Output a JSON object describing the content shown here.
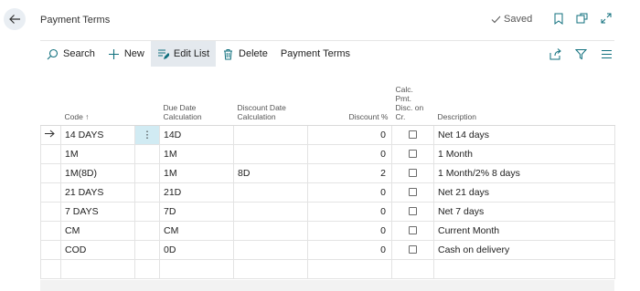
{
  "header": {
    "title": "Payment Terms",
    "saved_label": "Saved"
  },
  "toolbar": {
    "search_label": "Search",
    "new_label": "New",
    "edit_list_label": "Edit List",
    "delete_label": "Delete",
    "payment_terms_label": "Payment Terms"
  },
  "table": {
    "columns": {
      "code": "Code ↑",
      "due_date": "Due Date Calculation",
      "discount_date": "Discount Date Calculation",
      "discount_pct": "Discount %",
      "calc_pmt": "Calc. Pmt. Disc. on Cr.",
      "description": "Description"
    },
    "rows": [
      {
        "code": "14 DAYS",
        "due": "14D",
        "disc_date": "",
        "pct": "0",
        "desc": "Net 14 days"
      },
      {
        "code": "1M",
        "due": "1M",
        "disc_date": "",
        "pct": "0",
        "desc": "1 Month"
      },
      {
        "code": "1M(8D)",
        "due": "1M",
        "disc_date": "8D",
        "pct": "2",
        "desc": "1 Month/2% 8 days"
      },
      {
        "code": "21 DAYS",
        "due": "21D",
        "disc_date": "",
        "pct": "0",
        "desc": "Net 21 days"
      },
      {
        "code": "7 DAYS",
        "due": "7D",
        "disc_date": "",
        "pct": "0",
        "desc": "Net 7 days"
      },
      {
        "code": "CM",
        "due": "CM",
        "disc_date": "",
        "pct": "0",
        "desc": "Current Month"
      },
      {
        "code": "COD",
        "due": "0D",
        "disc_date": "",
        "pct": "0",
        "desc": "Cash on delivery"
      }
    ]
  },
  "icons": {
    "back": "arrow-left-icon",
    "saved_check": "check-icon",
    "bookmark": "bookmark-icon",
    "open_new": "open-in-new-window-icon",
    "expand": "expand-icon",
    "search": "search-icon",
    "new": "plus-icon",
    "edit_list": "edit-list-icon",
    "delete": "trash-icon",
    "share": "share-icon",
    "filter": "filter-icon",
    "list_view": "list-view-icon",
    "row_selector": "arrow-right-icon",
    "row_menu": "more-vertical-icon"
  },
  "colors": {
    "accent": "#0f6f7d",
    "selected_cell": "#d1ebf3",
    "active_button": "#e4e9ee"
  }
}
